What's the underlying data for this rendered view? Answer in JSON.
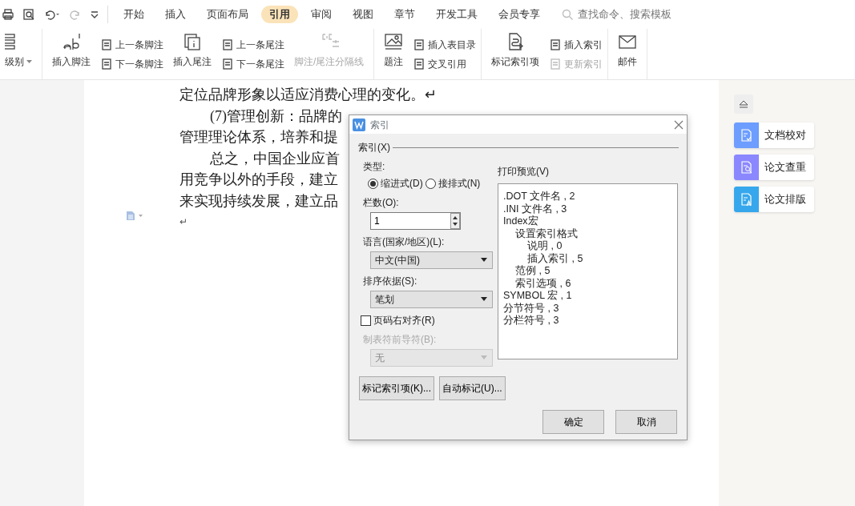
{
  "tabs": [
    {
      "label": "开始",
      "selected": false
    },
    {
      "label": "插入",
      "selected": false
    },
    {
      "label": "页面布局",
      "selected": false
    },
    {
      "label": "引用",
      "selected": true
    },
    {
      "label": "审阅",
      "selected": false
    },
    {
      "label": "视图",
      "selected": false
    },
    {
      "label": "章节",
      "selected": false
    },
    {
      "label": "开发工具",
      "selected": false
    },
    {
      "label": "会员专享",
      "selected": false
    }
  ],
  "search": {
    "placeholder": "查找命令、搜索模板"
  },
  "ribbon": [
    {
      "columns": [
        {
          "kind": "large",
          "label": "级别",
          "disabled": false,
          "dropdown": true
        }
      ]
    },
    {
      "columns": [
        {
          "kind": "large",
          "label": "插入脚注",
          "disabled": false,
          "dropdown": false
        },
        {
          "kind": "stack",
          "items": [
            {
              "label": "上一条脚注",
              "disabled": false
            },
            {
              "label": "下一条脚注",
              "disabled": false
            }
          ]
        },
        {
          "kind": "large",
          "label": "插入尾注",
          "disabled": false,
          "dropdown": false
        },
        {
          "kind": "stack",
          "items": [
            {
              "label": "上一条尾注",
              "disabled": false
            },
            {
              "label": "下一条尾注",
              "disabled": false
            }
          ]
        },
        {
          "kind": "large",
          "label": "脚注/尾注分隔线",
          "disabled": true,
          "dropdown": false
        }
      ]
    },
    {
      "columns": [
        {
          "kind": "large",
          "label": "题注",
          "disabled": false,
          "dropdown": false
        },
        {
          "kind": "stack",
          "items": [
            {
              "label": "插入表目录",
              "disabled": false
            },
            {
              "label": "交叉引用",
              "disabled": false
            }
          ]
        }
      ]
    },
    {
      "columns": [
        {
          "kind": "large",
          "label": "标记索引项",
          "disabled": false,
          "dropdown": false
        },
        {
          "kind": "stack",
          "items": [
            {
              "label": "插入索引",
              "disabled": false
            },
            {
              "label": "更新索引",
              "disabled": true
            }
          ]
        }
      ]
    },
    {
      "columns": [
        {
          "kind": "large",
          "label": "邮件",
          "disabled": false,
          "dropdown": false
        }
      ]
    }
  ],
  "document": {
    "lines": [
      {
        "kind": "continuation",
        "text": "定位品牌形象以适应消费心理的变化。↵"
      },
      {
        "kind": "first-line",
        "text": "(7)管理创新：品牌的"
      },
      {
        "kind": "continuation",
        "text": "管理理论体系，培养和提"
      },
      {
        "kind": "first-line",
        "text": "总之，中国企业应首"
      },
      {
        "kind": "continuation",
        "text": "用竞争以外的手段，建立"
      },
      {
        "kind": "continuation",
        "text": "来实现持续发展，建立品"
      },
      {
        "kind": "continuation",
        "text": "↵"
      }
    ]
  },
  "side_panel": {
    "items": [
      {
        "label": "文档校对",
        "color": "#6c9dff"
      },
      {
        "label": "论文查重",
        "color": "#8a87ff"
      },
      {
        "label": "论文排版",
        "color": "#36a7ec"
      }
    ]
  },
  "dialog": {
    "title": "索引",
    "section": "索引(X)",
    "type_label": "类型:",
    "types": [
      {
        "label": "缩进式(D)",
        "selected": true
      },
      {
        "label": "接排式(N)",
        "selected": false
      }
    ],
    "columns_label": "栏数(O):",
    "columns_value": "1",
    "language_label": "语言(国家/地区)(L):",
    "language_value": "中文(中国)",
    "sort_label": "排序依据(S):",
    "sort_value": "笔划",
    "right_align": {
      "label": "页码右对齐(R)",
      "checked": false
    },
    "leader_label": "制表符前导符(B):",
    "leader_value": "无",
    "leader_disabled": true,
    "preview_label": "打印预览(V)",
    "preview": [
      {
        "text": ".DOT 文件名 , 2"
      },
      {
        "text": ".INI 文件名 , 3"
      },
      {
        "text": "Index宏",
        "children": [
          {
            "text": "设置索引格式",
            "children": [
              {
                "text": "说明 , 0"
              },
              {
                "text": "插入索引 , 5"
              }
            ]
          },
          {
            "text": "范例 , 5"
          },
          {
            "text": "索引选项 , 6"
          }
        ]
      },
      {
        "text": "SYMBOL 宏 , 1"
      },
      {
        "text": "分节符号 , 3"
      },
      {
        "text": "分栏符号 , 3"
      }
    ],
    "buttons": [
      "标记索引项(K)...",
      "自动标记(U)..."
    ],
    "ok": "确定",
    "cancel": "取消"
  }
}
